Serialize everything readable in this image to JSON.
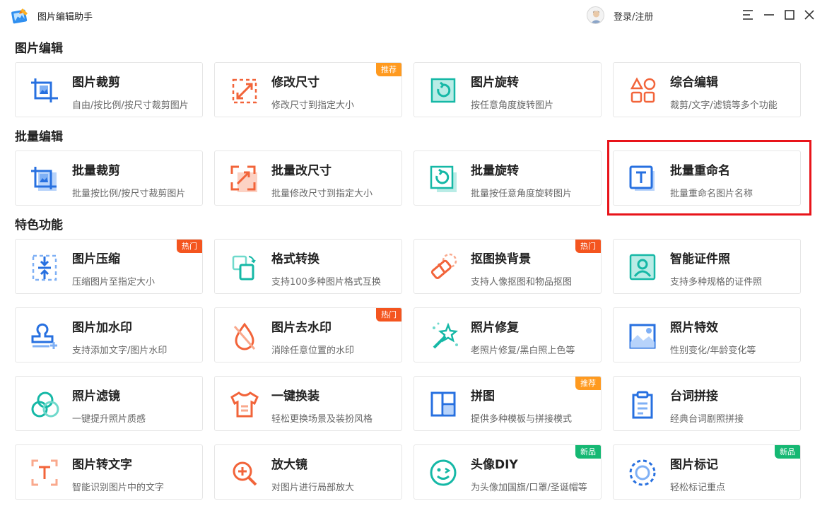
{
  "app": {
    "title": "图片编辑助手",
    "login_label": "登录/注册"
  },
  "colors": {
    "highlight": "#e8141a",
    "badge_orange": "#ff9a1f",
    "badge_red": "#f4551f",
    "badge_green": "#15b873"
  },
  "sections": [
    {
      "title": "图片编辑",
      "cards": [
        {
          "title": "图片裁剪",
          "desc": "自由/按比例/按尺寸裁剪图片",
          "icon": "crop-icon"
        },
        {
          "title": "修改尺寸",
          "desc": "修改尺寸到指定大小",
          "icon": "resize-icon",
          "badge": "推荐"
        },
        {
          "title": "图片旋转",
          "desc": "按任意角度旋转图片",
          "icon": "rotate-icon"
        },
        {
          "title": "综合编辑",
          "desc": "裁剪/文字/滤镜等多个功能",
          "icon": "shapes-icon"
        }
      ]
    },
    {
      "title": "批量编辑",
      "cards": [
        {
          "title": "批量裁剪",
          "desc": "批量按比例/按尺寸裁剪图片",
          "icon": "batch-crop-icon"
        },
        {
          "title": "批量改尺寸",
          "desc": "批量修改尺寸到指定大小",
          "icon": "batch-resize-icon"
        },
        {
          "title": "批量旋转",
          "desc": "批量按任意角度旋转图片",
          "icon": "batch-rotate-icon"
        },
        {
          "title": "批量重命名",
          "desc": "批量重命名图片名称",
          "icon": "text-t-icon"
        }
      ]
    },
    {
      "title": "特色功能",
      "cards": [
        {
          "title": "图片压缩",
          "desc": "压缩图片至指定大小",
          "icon": "compress-icon",
          "badge": "热门"
        },
        {
          "title": "格式转换",
          "desc": "支持100多种图片格式互换",
          "icon": "format-convert-icon"
        },
        {
          "title": "抠图换背景",
          "desc": "支持人像抠图和物品抠图",
          "icon": "eraser-icon",
          "badge": "热门"
        },
        {
          "title": "智能证件照",
          "desc": "支持多种规格的证件照",
          "icon": "id-photo-icon"
        },
        {
          "title": "图片加水印",
          "desc": "支持添加文字/图片水印",
          "icon": "stamp-icon"
        },
        {
          "title": "图片去水印",
          "desc": "消除任意位置的水印",
          "icon": "drop-off-icon",
          "badge": "热门"
        },
        {
          "title": "照片修复",
          "desc": "老照片修复/黑白照上色等",
          "icon": "magic-wand-icon"
        },
        {
          "title": "照片特效",
          "desc": "性别变化/年龄变化等",
          "icon": "landscape-icon"
        },
        {
          "title": "照片滤镜",
          "desc": "一键提升照片质感",
          "icon": "filter-circles-icon"
        },
        {
          "title": "一键换装",
          "desc": "轻松更换场景及装扮风格",
          "icon": "tshirt-icon"
        },
        {
          "title": "拼图",
          "desc": "提供多种模板与拼接模式",
          "icon": "collage-icon",
          "badge": "推荐"
        },
        {
          "title": "台词拼接",
          "desc": "经典台词剧照拼接",
          "icon": "clipboard-icon"
        },
        {
          "title": "图片转文字",
          "desc": "智能识别图片中的文字",
          "icon": "ocr-t-icon"
        },
        {
          "title": "放大镜",
          "desc": "对图片进行局部放大",
          "icon": "magnifier-icon"
        },
        {
          "title": "头像DIY",
          "desc": "为头像加国旗/口罩/圣诞帽等",
          "icon": "smile-icon",
          "badge": "新品"
        },
        {
          "title": "图片标记",
          "desc": "轻松标记重点",
          "icon": "mark-circle-icon",
          "badge": "新品"
        }
      ]
    }
  ]
}
